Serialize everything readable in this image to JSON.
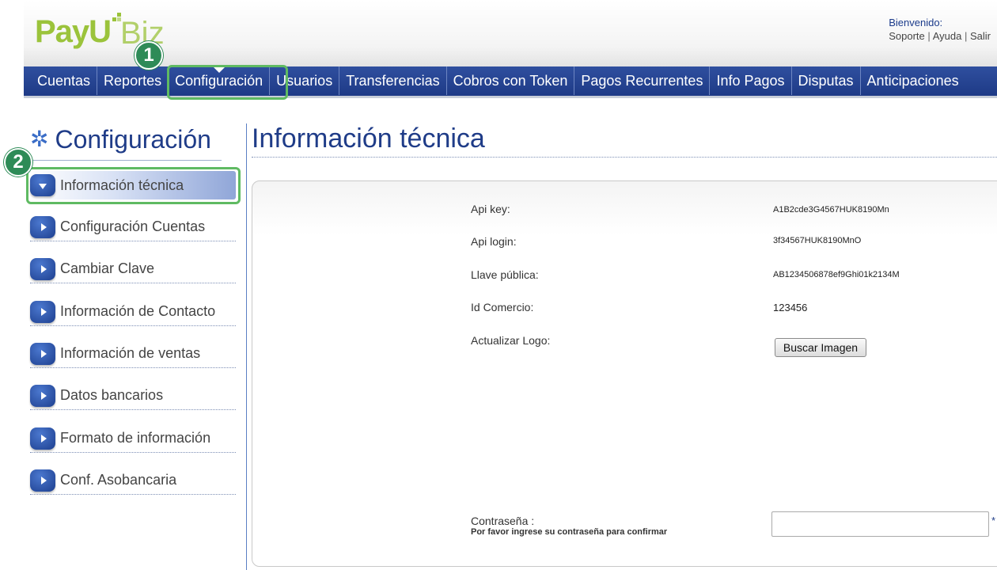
{
  "header": {
    "logo_text": "PayU Biz",
    "welcome_title": "Bienvenido:",
    "links": [
      "Soporte",
      "Ayuda",
      "Salir"
    ]
  },
  "nav": {
    "items": [
      "Cuentas",
      "Reportes",
      "Configuración",
      "Usuarios",
      "Transferencias",
      "Cobros con Token",
      "Pagos Recurrentes",
      "Info Pagos",
      "Disputas",
      "Anticipaciones"
    ],
    "active": "Configuración"
  },
  "annotations": {
    "step1": "1",
    "step2": "2",
    "highlight_color": "#5fba62"
  },
  "sidebar": {
    "title": "Configuración",
    "items": [
      {
        "label": "Información técnica",
        "active": true
      },
      {
        "label": "Configuración Cuentas"
      },
      {
        "label": "Cambiar Clave"
      },
      {
        "label": "Información de Contacto"
      },
      {
        "label": "Información de ventas"
      },
      {
        "label": "Datos bancarios"
      },
      {
        "label": "Formato de información"
      },
      {
        "label": "Conf. Asobancaria"
      }
    ]
  },
  "main": {
    "title": "Información técnica",
    "fields": [
      {
        "label": "Api key:",
        "value": "A1B2cde3G4567HUK8190Mn"
      },
      {
        "label": "Api login:",
        "value": "3f34567HUK8190MnO"
      },
      {
        "label": "Llave pública:",
        "value": "AB1234506878ef9Ghi01k2134M"
      },
      {
        "label": "Id Comercio:",
        "value": "123456"
      },
      {
        "label": "Actualizar Logo:",
        "value": ""
      }
    ],
    "logo_button": "Buscar Imagen",
    "password_label": "Contraseña :",
    "password_hint": "Por favor ingrese su contraseña para confirmar",
    "password_value": "",
    "required_mark": "*"
  },
  "colors": {
    "brand_green": "#9bc33b",
    "nav_blue": "#1e3a86",
    "title_blue": "#1f3c88"
  }
}
